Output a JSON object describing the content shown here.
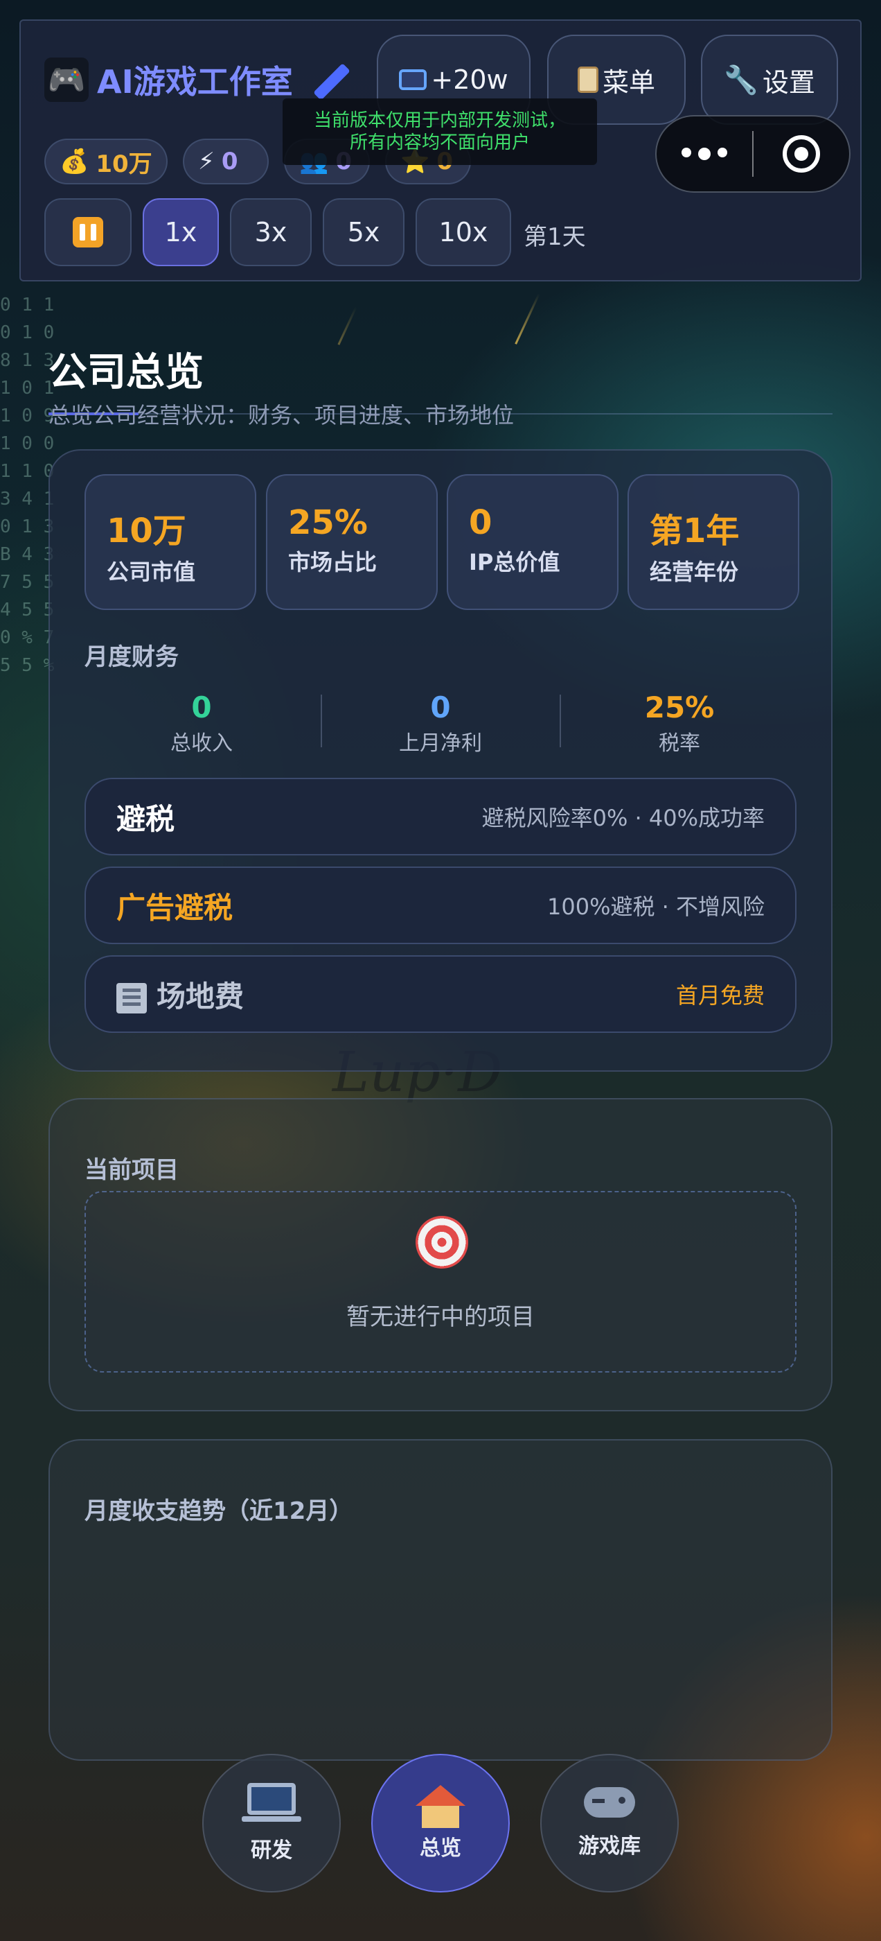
{
  "app": {
    "title": "AI游戏工作室",
    "brand_icon": "gamepad-icon",
    "edit_icon": "pen-icon"
  },
  "toolbar": {
    "ad_button": {
      "icon": "tv-icon",
      "label": "+20w"
    },
    "menu_button": {
      "icon": "clipboard-icon",
      "label": "菜单"
    },
    "settings_button": {
      "icon": "wrench-icon",
      "label": "设置"
    }
  },
  "notice": {
    "line1": "当前版本仅用于内部开发测试，",
    "line2": "所有内容均不面向用户"
  },
  "stats": [
    {
      "icon": "money-bag-icon",
      "glyph": "💰",
      "value": "10万",
      "color": "#f0b33a"
    },
    {
      "icon": "lightning-icon",
      "glyph": "⚡",
      "value": "0",
      "color": "#a99cf5"
    },
    {
      "icon": "people-icon",
      "glyph": "👥",
      "value": "0",
      "color": "#a99cf5"
    },
    {
      "icon": "star-icon",
      "glyph": "⭐",
      "value": "0",
      "color": "#f0b33a"
    }
  ],
  "speed": {
    "options": [
      "1x",
      "3x",
      "5x",
      "10x"
    ],
    "selected": "1x",
    "day": "第1天"
  },
  "overview": {
    "title": "公司总览",
    "subtitle": "总览公司经营状况：财务、项目进度、市场地位"
  },
  "kpis": [
    {
      "value": "10万",
      "label": "公司市值",
      "color": "#f5a623"
    },
    {
      "value": "25%",
      "label": "市场占比",
      "color": "#f5a623"
    },
    {
      "value": "0",
      "label": "IP总价值",
      "color": "#f5a623"
    },
    {
      "value": "第1年",
      "label": "经营年份",
      "color": "#f5a623"
    }
  ],
  "finance": {
    "title": "月度财务",
    "items": [
      {
        "value": "0",
        "label": "总收入",
        "color": "#34d399"
      },
      {
        "value": "0",
        "label": "上月净利",
        "color": "#60a5fa"
      },
      {
        "value": "25%",
        "label": "税率",
        "color": "#f5a623"
      }
    ]
  },
  "actions": [
    {
      "title": "避税",
      "detail": "避税风险率0% · 40%成功率",
      "title_color": "#ffffff",
      "detail_color": "#aab4c8"
    },
    {
      "title": "广告避税",
      "detail": "100%避税 · 不增风险",
      "title_color": "#f5a623",
      "detail_color": "#aab4c8"
    },
    {
      "title": "场地费",
      "detail": "首月免费",
      "icon": "building-icon",
      "title_color": "#c0c8d8",
      "detail_color": "#f5a623"
    }
  ],
  "projects": {
    "title": "当前项目",
    "empty_icon": "target-icon",
    "empty_text": "暂无进行中的项目"
  },
  "trend": {
    "title": "月度收支趋势（近12月）"
  },
  "nav": [
    {
      "icon": "laptop-icon",
      "label": "研发",
      "active": false
    },
    {
      "icon": "house-icon",
      "label": "总览",
      "active": true
    },
    {
      "icon": "gamepad-icon",
      "label": "游戏库",
      "active": false
    }
  ]
}
